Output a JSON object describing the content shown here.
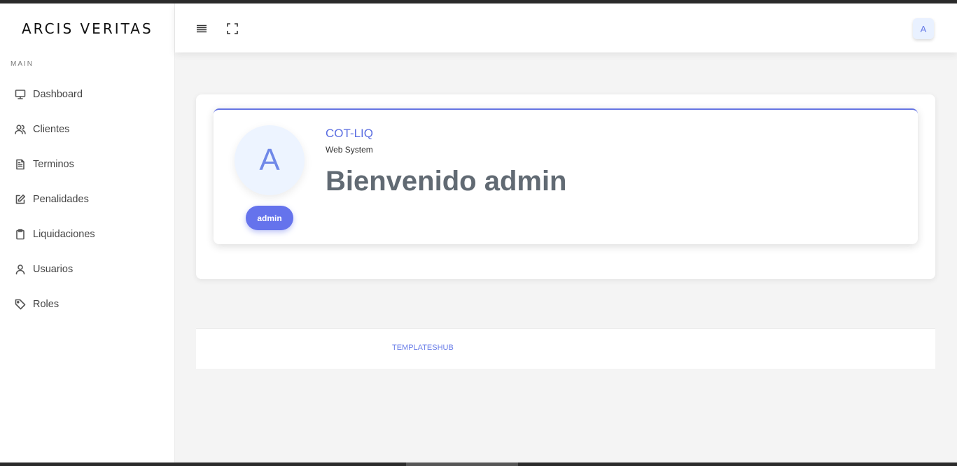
{
  "brand": "ARCIS VERITAS",
  "sidebar": {
    "section_label": "MAIN",
    "items": [
      {
        "label": "Dashboard",
        "icon": "monitor-icon"
      },
      {
        "label": "Clientes",
        "icon": "users-icon"
      },
      {
        "label": "Terminos",
        "icon": "document-icon"
      },
      {
        "label": "Penalidades",
        "icon": "edit-icon"
      },
      {
        "label": "Liquidaciones",
        "icon": "clipboard-icon"
      },
      {
        "label": "Usuarios",
        "icon": "user-icon"
      },
      {
        "label": "Roles",
        "icon": "tag-icon"
      }
    ]
  },
  "topbar": {
    "menu_icon": "hamburger-icon",
    "fullscreen_icon": "fullscreen-icon",
    "user_initial": "A"
  },
  "profile": {
    "avatar_initial": "A",
    "role": "admin",
    "app_name": "COT-LIQ",
    "app_subtitle": "Web System",
    "welcome": "Bienvenido admin"
  },
  "footer": {
    "link": "TEMPLATESHUB"
  },
  "colors": {
    "accent": "#6573ec",
    "link": "#5b6ee1",
    "background": "#f4f4f4"
  }
}
